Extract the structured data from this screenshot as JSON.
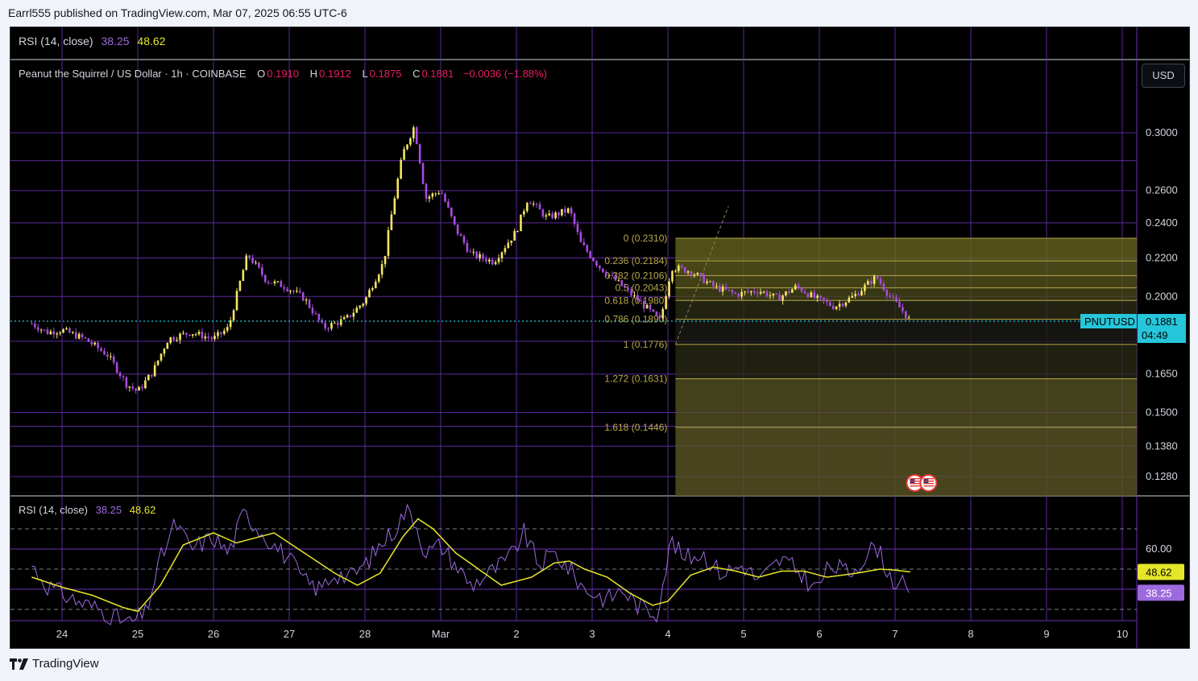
{
  "header": {
    "published_text": "Earrl555 published on TradingView.com, Mar 07, 2025 06:55 UTC-6"
  },
  "top_rsi": {
    "label": "RSI (14, close)",
    "value": "38.25",
    "ma": "48.62"
  },
  "main_legend": {
    "symbol": "Peanut the Squirrel / US Dollar · 1h · COINBASE",
    "o_label": "O",
    "o": "0.1910",
    "h_label": "H",
    "h": "0.1912",
    "l_label": "L",
    "l": "0.1875",
    "c_label": "C",
    "c": "0.1881",
    "change": "−0.0036 (−1.88%)"
  },
  "currency_button": "USD",
  "price_axis": {
    "ticks": [
      "0.3000",
      "0.2600",
      "0.2400",
      "0.2200",
      "0.2000",
      "0.1650",
      "0.1500",
      "0.1380",
      "0.1280"
    ],
    "last_price": "0.1881",
    "countdown": "04:49",
    "symbol_tag": "PNUTUSD"
  },
  "fib_levels": [
    {
      "label": "0 (0.2310)",
      "price": 0.231
    },
    {
      "label": "0.236 (0.2184)",
      "price": 0.2184
    },
    {
      "label": "0.382 (0.2106)",
      "price": 0.2106
    },
    {
      "label": "0.5 (0.2043)",
      "price": 0.2043
    },
    {
      "label": "0.618 (0.1980)",
      "price": 0.198
    },
    {
      "label": "0.786 (0.1890)",
      "price": 0.189
    },
    {
      "label": "1 (0.1776)",
      "price": 0.1776
    },
    {
      "label": "1.272 (0.1631)",
      "price": 0.1631
    },
    {
      "label": "1.618 (0.1446)",
      "price": 0.1446
    }
  ],
  "time_axis": [
    "24",
    "25",
    "26",
    "27",
    "28",
    "Mar",
    "2",
    "3",
    "4",
    "5",
    "6",
    "7",
    "8",
    "9",
    "10"
  ],
  "rsi_pane": {
    "legend_label": "RSI (14, close)",
    "rsi_value": "38.25",
    "ma_value": "48.62",
    "axis_tick": "60.00",
    "ma_tag": "48.62",
    "rsi_tag": "38.25"
  },
  "footer": {
    "brand": "TradingView"
  },
  "chart_data": {
    "type": "candlestick",
    "symbol": "PNUTUSD",
    "timeframe": "1h",
    "price_close_path": [
      [
        23.6,
        0.187
      ],
      [
        23.8,
        0.183
      ],
      [
        24.0,
        0.184
      ],
      [
        24.3,
        0.18
      ],
      [
        24.6,
        0.173
      ],
      [
        24.85,
        0.161
      ],
      [
        25.0,
        0.158
      ],
      [
        25.2,
        0.166
      ],
      [
        25.4,
        0.18
      ],
      [
        25.7,
        0.183
      ],
      [
        26.0,
        0.18
      ],
      [
        26.2,
        0.185
      ],
      [
        26.45,
        0.222
      ],
      [
        26.7,
        0.208
      ],
      [
        26.95,
        0.205
      ],
      [
        27.2,
        0.199
      ],
      [
        27.45,
        0.185
      ],
      [
        27.75,
        0.189
      ],
      [
        28.0,
        0.198
      ],
      [
        28.25,
        0.218
      ],
      [
        28.5,
        0.285
      ],
      [
        28.65,
        0.305
      ],
      [
        28.8,
        0.255
      ],
      [
        29.0,
        0.26
      ],
      [
        29.2,
        0.236
      ],
      [
        29.4,
        0.222
      ],
      [
        29.7,
        0.218
      ],
      [
        30.0,
        0.235
      ],
      [
        30.15,
        0.255
      ],
      [
        30.4,
        0.243
      ],
      [
        30.7,
        0.248
      ],
      [
        30.85,
        0.228
      ],
      [
        31.1,
        0.215
      ],
      [
        31.4,
        0.205
      ],
      [
        31.7,
        0.195
      ],
      [
        31.9,
        0.188
      ],
      [
        32.05,
        0.215
      ],
      [
        32.3,
        0.213
      ],
      [
        32.6,
        0.205
      ],
      [
        32.9,
        0.201
      ],
      [
        33.2,
        0.203
      ],
      [
        33.45,
        0.199
      ],
      [
        33.7,
        0.205
      ],
      [
        33.95,
        0.199
      ],
      [
        34.2,
        0.195
      ],
      [
        34.45,
        0.2
      ],
      [
        34.75,
        0.21
      ],
      [
        34.95,
        0.199
      ],
      [
        35.1,
        0.193
      ],
      [
        35.2,
        0.1881
      ]
    ],
    "rsi": {
      "value": 38.25,
      "ma": 48.62,
      "levels": [
        30,
        50,
        70
      ],
      "ma_path": [
        [
          23.6,
          46
        ],
        [
          24.0,
          41
        ],
        [
          24.4,
          37
        ],
        [
          24.8,
          31
        ],
        [
          25.0,
          29
        ],
        [
          25.3,
          42
        ],
        [
          25.6,
          62
        ],
        [
          26.0,
          68
        ],
        [
          26.3,
          63
        ],
        [
          26.8,
          68
        ],
        [
          27.2,
          58
        ],
        [
          27.6,
          48
        ],
        [
          27.9,
          42
        ],
        [
          28.2,
          48
        ],
        [
          28.5,
          66
        ],
        [
          28.7,
          75
        ],
        [
          28.9,
          70
        ],
        [
          29.2,
          58
        ],
        [
          29.5,
          50
        ],
        [
          29.8,
          42
        ],
        [
          30.2,
          46
        ],
        [
          30.5,
          53
        ],
        [
          30.7,
          54
        ],
        [
          30.9,
          50
        ],
        [
          31.2,
          46
        ],
        [
          31.5,
          38
        ],
        [
          31.8,
          32
        ],
        [
          32.0,
          34
        ],
        [
          32.3,
          47
        ],
        [
          32.6,
          51
        ],
        [
          32.9,
          49
        ],
        [
          33.2,
          46
        ],
        [
          33.5,
          49
        ],
        [
          33.8,
          49
        ],
        [
          34.1,
          46
        ],
        [
          34.5,
          48
        ],
        [
          34.8,
          50
        ],
        [
          35.0,
          49.5
        ],
        [
          35.2,
          48.6
        ]
      ],
      "path": [
        [
          23.6,
          52
        ],
        [
          23.8,
          42
        ],
        [
          24.0,
          38
        ],
        [
          24.2,
          34
        ],
        [
          24.5,
          30
        ],
        [
          24.7,
          26
        ],
        [
          24.9,
          23
        ],
        [
          25.1,
          28
        ],
        [
          25.3,
          55
        ],
        [
          25.5,
          73
        ],
        [
          25.7,
          60
        ],
        [
          26.0,
          66
        ],
        [
          26.2,
          58
        ],
        [
          26.4,
          78
        ],
        [
          26.6,
          70
        ],
        [
          26.8,
          62
        ],
        [
          27.0,
          55
        ],
        [
          27.2,
          44
        ],
        [
          27.4,
          40
        ],
        [
          27.6,
          48
        ],
        [
          27.8,
          46
        ],
        [
          28.0,
          52
        ],
        [
          28.2,
          62
        ],
        [
          28.4,
          70
        ],
        [
          28.55,
          80
        ],
        [
          28.65,
          75
        ],
        [
          28.8,
          58
        ],
        [
          29.0,
          62
        ],
        [
          29.2,
          52
        ],
        [
          29.4,
          42
        ],
        [
          29.6,
          47
        ],
        [
          29.9,
          55
        ],
        [
          30.1,
          68
        ],
        [
          30.3,
          52
        ],
        [
          30.5,
          58
        ],
        [
          30.7,
          50
        ],
        [
          30.9,
          40
        ],
        [
          31.2,
          35
        ],
        [
          31.4,
          40
        ],
        [
          31.6,
          32
        ],
        [
          31.85,
          28
        ],
        [
          32.05,
          65
        ],
        [
          32.2,
          55
        ],
        [
          32.45,
          58
        ],
        [
          32.7,
          48
        ],
        [
          33.0,
          52
        ],
        [
          33.2,
          44
        ],
        [
          33.5,
          55
        ],
        [
          33.75,
          48
        ],
        [
          33.95,
          40
        ],
        [
          34.15,
          52
        ],
        [
          34.4,
          48
        ],
        [
          34.6,
          56
        ],
        [
          34.75,
          62
        ],
        [
          34.95,
          45
        ],
        [
          35.1,
          42
        ],
        [
          35.2,
          38.25
        ]
      ]
    },
    "fib_retracement": {
      "start_time": 32.1,
      "end_time": 35.3,
      "levels": [
        {
          "ratio": 0,
          "price": 0.231
        },
        {
          "ratio": 0.236,
          "price": 0.2184
        },
        {
          "ratio": 0.382,
          "price": 0.2106
        },
        {
          "ratio": 0.5,
          "price": 0.2043
        },
        {
          "ratio": 0.618,
          "price": 0.198
        },
        {
          "ratio": 0.786,
          "price": 0.189
        },
        {
          "ratio": 1,
          "price": 0.1776
        },
        {
          "ratio": 1.272,
          "price": 0.1631
        },
        {
          "ratio": 1.618,
          "price": 0.1446
        }
      ]
    },
    "last_price": 0.1881,
    "y_scale": "log",
    "grid": true
  },
  "colors": {
    "background": "#000000",
    "grid": "#6a2fb5",
    "up": "#f5e663",
    "down": "#a84cde",
    "fib": "#b8a84a",
    "rsi": "#9c6ade",
    "rsi_ma": "#e6e629",
    "last_price": "#26c6da"
  }
}
